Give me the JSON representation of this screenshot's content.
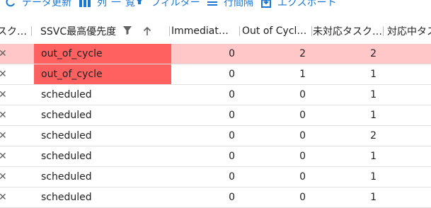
{
  "toolbar": {
    "items": [
      {
        "label": "データ更新",
        "icon": "refresh-icon"
      },
      {
        "label": "列一覧",
        "icon": "columns-icon"
      },
      {
        "label": "フィルター",
        "icon": "filter-icon"
      },
      {
        "label": "行間隔",
        "icon": "density-icon"
      },
      {
        "label": "エクスポート",
        "icon": "export-icon"
      }
    ]
  },
  "table": {
    "columns": [
      {
        "label": "スクリ…"
      },
      {
        "label": "SSVC最高優先度",
        "sort": "ascending",
        "filtered": true
      },
      {
        "label": "Immediate…"
      },
      {
        "label": "Out of Cycl…"
      },
      {
        "label": "未対応タスク…"
      },
      {
        "label": "対応中タスク"
      }
    ],
    "rows": [
      {
        "priority": "out_of_cycle",
        "immediate": "0",
        "out_of_cycle": "2",
        "open_tasks": "2",
        "highlight": true,
        "priority_color": "#ff6161"
      },
      {
        "priority": "out_of_cycle",
        "immediate": "0",
        "out_of_cycle": "1",
        "open_tasks": "1",
        "highlight": false,
        "priority_color": "#ff6161"
      },
      {
        "priority": "scheduled",
        "immediate": "0",
        "out_of_cycle": "0",
        "open_tasks": "1",
        "highlight": false
      },
      {
        "priority": "scheduled",
        "immediate": "0",
        "out_of_cycle": "0",
        "open_tasks": "1",
        "highlight": false
      },
      {
        "priority": "scheduled",
        "immediate": "0",
        "out_of_cycle": "0",
        "open_tasks": "2",
        "highlight": false
      },
      {
        "priority": "scheduled",
        "immediate": "0",
        "out_of_cycle": "0",
        "open_tasks": "1",
        "highlight": false
      },
      {
        "priority": "scheduled",
        "immediate": "0",
        "out_of_cycle": "0",
        "open_tasks": "1",
        "highlight": false
      },
      {
        "priority": "scheduled",
        "immediate": "0",
        "out_of_cycle": "0",
        "open_tasks": "1",
        "highlight": false
      }
    ]
  },
  "colors": {
    "accent": "#1976d2",
    "row_highlight": "#ffc7c7",
    "priority_red": "#ff6161"
  }
}
